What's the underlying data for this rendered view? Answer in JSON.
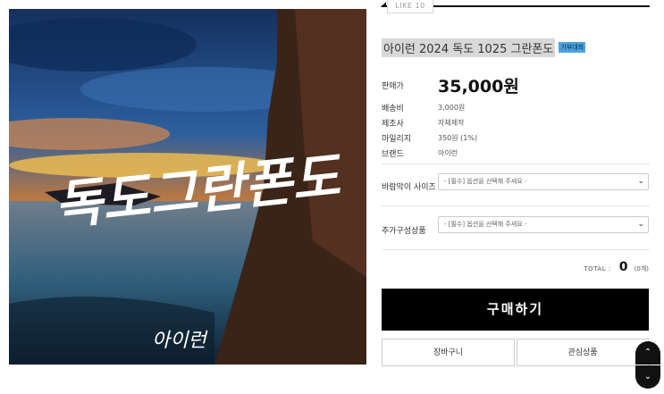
{
  "hero": {
    "calligraphy": "독도그란폰도",
    "signature": "아이런"
  },
  "like": {
    "label": "LIKE 10"
  },
  "product": {
    "title": "아이런 2024 독도 1025 그란폰도",
    "badge": "기부대회",
    "price_label": "판매가",
    "price": "35,000원"
  },
  "details": [
    {
      "label": "배송비",
      "value": "3,000원"
    },
    {
      "label": "제조사",
      "value": "자체제작"
    },
    {
      "label": "마일리지",
      "value": "350원 (1%)"
    },
    {
      "label": "브랜드",
      "value": "아이런"
    }
  ],
  "options": [
    {
      "label": "바람막이 사이즈",
      "value": "- [필수] 옵션을 선택해 주세요 -"
    },
    {
      "label": "추가구성상품",
      "value": "- [필수] 옵션을 선택해 주세요 -"
    }
  ],
  "total": {
    "label": "TOTAL :",
    "amount": "0",
    "count": "(0개)"
  },
  "buttons": {
    "buy": "구매하기",
    "cart": "장바구니",
    "wishlist": "관심상품"
  },
  "scroll": {
    "up_icon": "chevron-up-icon",
    "down_icon": "chevron-down-icon"
  }
}
